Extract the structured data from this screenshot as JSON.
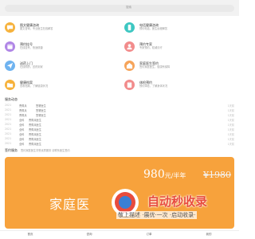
{
  "search": {
    "placeholder": "搜索"
  },
  "services": [
    {
      "title": "图文健康咨询",
      "desc": "图文咨询，专业医生在线解答",
      "color": "#f6b23c",
      "icon": "chat-icon"
    },
    {
      "title": "电话健康咨询",
      "desc": "预约电话，医生远程解答",
      "color": "#3ec7c2",
      "icon": "phone-icon"
    },
    {
      "title": "预约挂号",
      "desc": "在线挂号，快速便捷",
      "color": "#b086e6",
      "icon": "calendar-icon"
    },
    {
      "title": "预约专家",
      "desc": "专家预约，权威诊疗",
      "color": "#f28c8c",
      "icon": "doctor-icon"
    },
    {
      "title": "送药上门",
      "desc": "在线购药，送药到家",
      "color": "#6fb3f0",
      "icon": "send-icon"
    },
    {
      "title": "家庭医生签约",
      "desc": "签约家庭医生，健康有保障",
      "color": "#f6a45a",
      "icon": "house-icon"
    },
    {
      "title": "健康档案",
      "desc": "查看档案，了解健康状况",
      "color": "#f6b23c",
      "icon": "folder-icon"
    },
    {
      "title": "体检预约",
      "desc": "预约体检，了解身体状况",
      "color": "#f28c8c",
      "icon": "clipboard-icon"
    }
  ],
  "activity": {
    "title": "服务动态",
    "rows": [
      {
        "num": "2021",
        "name": "曹佩兵",
        "action": "签署医生",
        "time": "1天前"
      },
      {
        "num": "2021",
        "name": "曹佩兵",
        "action": "签署医生",
        "time": "1天前"
      },
      {
        "num": "2021",
        "name": "曹佩兵",
        "action": "签署医生",
        "time": "1天前"
      },
      {
        "num": "2021",
        "name": "全科",
        "action": "曹佩兵医生",
        "time": "1天前"
      },
      {
        "num": "2021",
        "name": "全科",
        "action": "曹佩兵医生",
        "time": "1天前"
      },
      {
        "num": "2021",
        "name": "全科",
        "action": "曹佩兵医生",
        "time": "1天前"
      },
      {
        "num": "2021",
        "name": "全科",
        "action": "曹佩兵医生",
        "time": "1天前"
      },
      {
        "num": "2021",
        "name": "全科",
        "action": "曹佩兵医生",
        "time": "1天前"
      },
      {
        "num": "2021",
        "name": "全科",
        "action": "曹佩兵医生",
        "time": "1天前"
      }
    ]
  },
  "share": {
    "title": "签约服务",
    "desc": "签约家庭医生享受优质服务 请联系医生签约"
  },
  "promo": {
    "price": "980",
    "unit": "元/半年",
    "old_price": "¥1980",
    "title": "家庭医",
    "watermark": "自动秒收录",
    "watermark_sub": "敬上描述 ·展优·一次 ·启动收录·"
  },
  "nav": [
    "首页",
    "咨询",
    "订单",
    "我的"
  ]
}
